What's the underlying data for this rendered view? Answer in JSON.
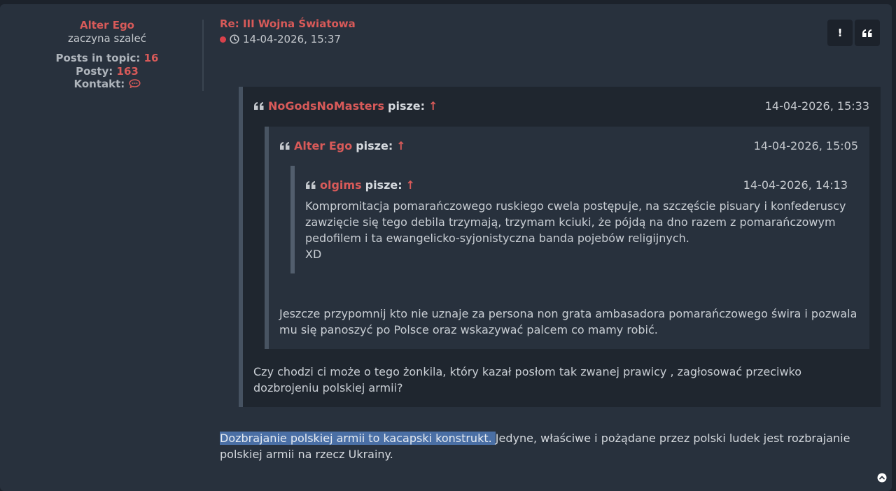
{
  "profile": {
    "username": "Alter Ego",
    "rank": "zaczyna szaleć",
    "posts_in_topic_label": "Posts in topic:",
    "posts_in_topic_value": "16",
    "posts_label": "Posty:",
    "posts_value": "163",
    "contact_label": "Kontakt:"
  },
  "post": {
    "title": "Re: III Wojna Światowa",
    "datetime": "14-04-2026, 15:37",
    "report_button": "!",
    "quote_button": "❝"
  },
  "quote1": {
    "author": "NoGodsNoMasters",
    "writes": "pisze:",
    "arrow": "↑",
    "datetime": "14-04-2026, 15:33",
    "text": "Czy chodzi ci może o tego żonkila, który kazał posłom tak zwanej prawicy , zagłosować przeciwko dozbrojeniu polskiej armii?"
  },
  "quote2": {
    "author": "Alter Ego",
    "writes": "pisze:",
    "arrow": "↑",
    "datetime": "14-04-2026, 15:05",
    "text": "Jeszcze przypomnij kto nie uznaje za persona non grata ambasadora pomarańczowego świra i pozwala mu się panoszyć po Polsce oraz wskazywać palcem co mamy robić."
  },
  "quote3": {
    "author": "olgims",
    "writes": "pisze:",
    "arrow": "↑",
    "datetime": "14-04-2026, 14:13",
    "line1": "Kompromitacja pomarańczowego ruskiego cwela postępuje, na szczęście pisuary i konfederuscy",
    "line2": "zawzięcie się tego debila trzymają, trzymam kciuki, że pójdą na dno razem z pomarańczowym",
    "line3": "pedofilem i ta ewangelicko-syjonistyczna banda pojebów religijnych.",
    "line4": "XD"
  },
  "reply": {
    "selected_text": "Dozbrajanie polskiej armii to kacapski konstrukt. ",
    "rest_text": "Jedyne, właściwe i pożądane przez polski ludek jest rozbrajanie polskiej armii na rzecz Ukrainy."
  },
  "colors": {
    "accent": "#d85a59",
    "background": "#28313d",
    "quote_bg": "#1f262f",
    "selection": "#4a6fa5"
  },
  "icons": {
    "contact": "speech-bubble-icon",
    "clock": "clock-icon",
    "quote": "quote-icon",
    "scroll_top": "chevron-up-circle-icon"
  }
}
